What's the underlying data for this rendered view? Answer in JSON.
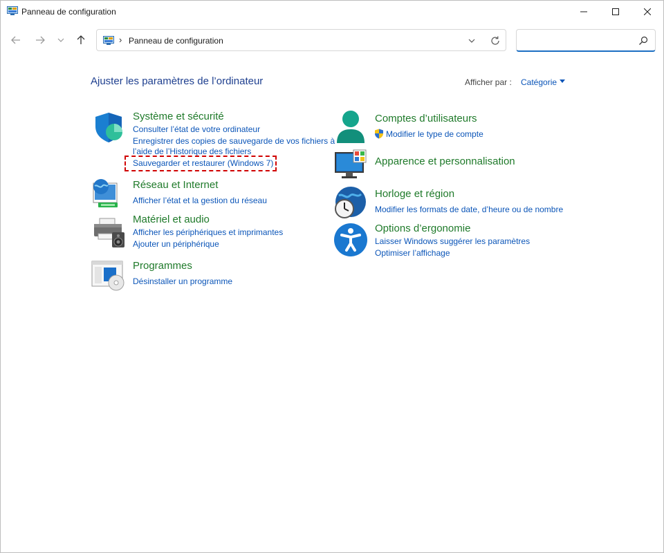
{
  "window": {
    "title": "Panneau de configuration"
  },
  "address": {
    "path": "Panneau de configuration",
    "separator": "›"
  },
  "search": {
    "placeholder": "",
    "value": ""
  },
  "content": {
    "heading": "Ajuster les paramètres de l’ordinateur",
    "view_by_label": "Afficher par :",
    "view_by_value": "Catégorie"
  },
  "categories": {
    "system": {
      "title": "Système et sécurité",
      "links": [
        "Consulter l’état de votre ordinateur",
        "Enregistrer des copies de sauvegarde de vos fichiers à",
        "l’aide de l’Historique des fichiers",
        "Sauvegarder et restaurer (Windows 7)"
      ]
    },
    "network": {
      "title": "Réseau et Internet",
      "links": [
        "Afficher l’état et la gestion du réseau"
      ]
    },
    "hardware": {
      "title": "Matériel et audio",
      "links": [
        "Afficher les périphériques et imprimantes",
        "Ajouter un périphérique"
      ]
    },
    "programs": {
      "title": "Programmes",
      "links": [
        "Désinstaller un programme"
      ]
    },
    "accounts": {
      "title": "Comptes d’utilisateurs",
      "links": [
        "Modifier le type de compte"
      ]
    },
    "appearance": {
      "title": "Apparence et personnalisation",
      "links": []
    },
    "clock": {
      "title": "Horloge et région",
      "links": [
        "Modifier les formats de date, d’heure ou de nombre"
      ]
    },
    "ease": {
      "title": "Options d’ergonomie",
      "links": [
        "Laisser Windows suggérer les paramètres",
        "Optimiser l’affichage"
      ]
    }
  },
  "colors": {
    "heading": "#1e3f8f",
    "category_title": "#1f7a2a",
    "link": "#0b55b8",
    "highlight": "#d00000"
  },
  "icons": {
    "control_panel": "control-panel-icon",
    "minimize": "minimize-icon",
    "maximize": "maximize-icon",
    "close": "close-icon",
    "back": "back-arrow-icon",
    "forward": "forward-arrow-icon",
    "recent": "chevron-down-icon",
    "up": "up-arrow-icon",
    "refresh": "refresh-icon",
    "search": "search-icon"
  }
}
